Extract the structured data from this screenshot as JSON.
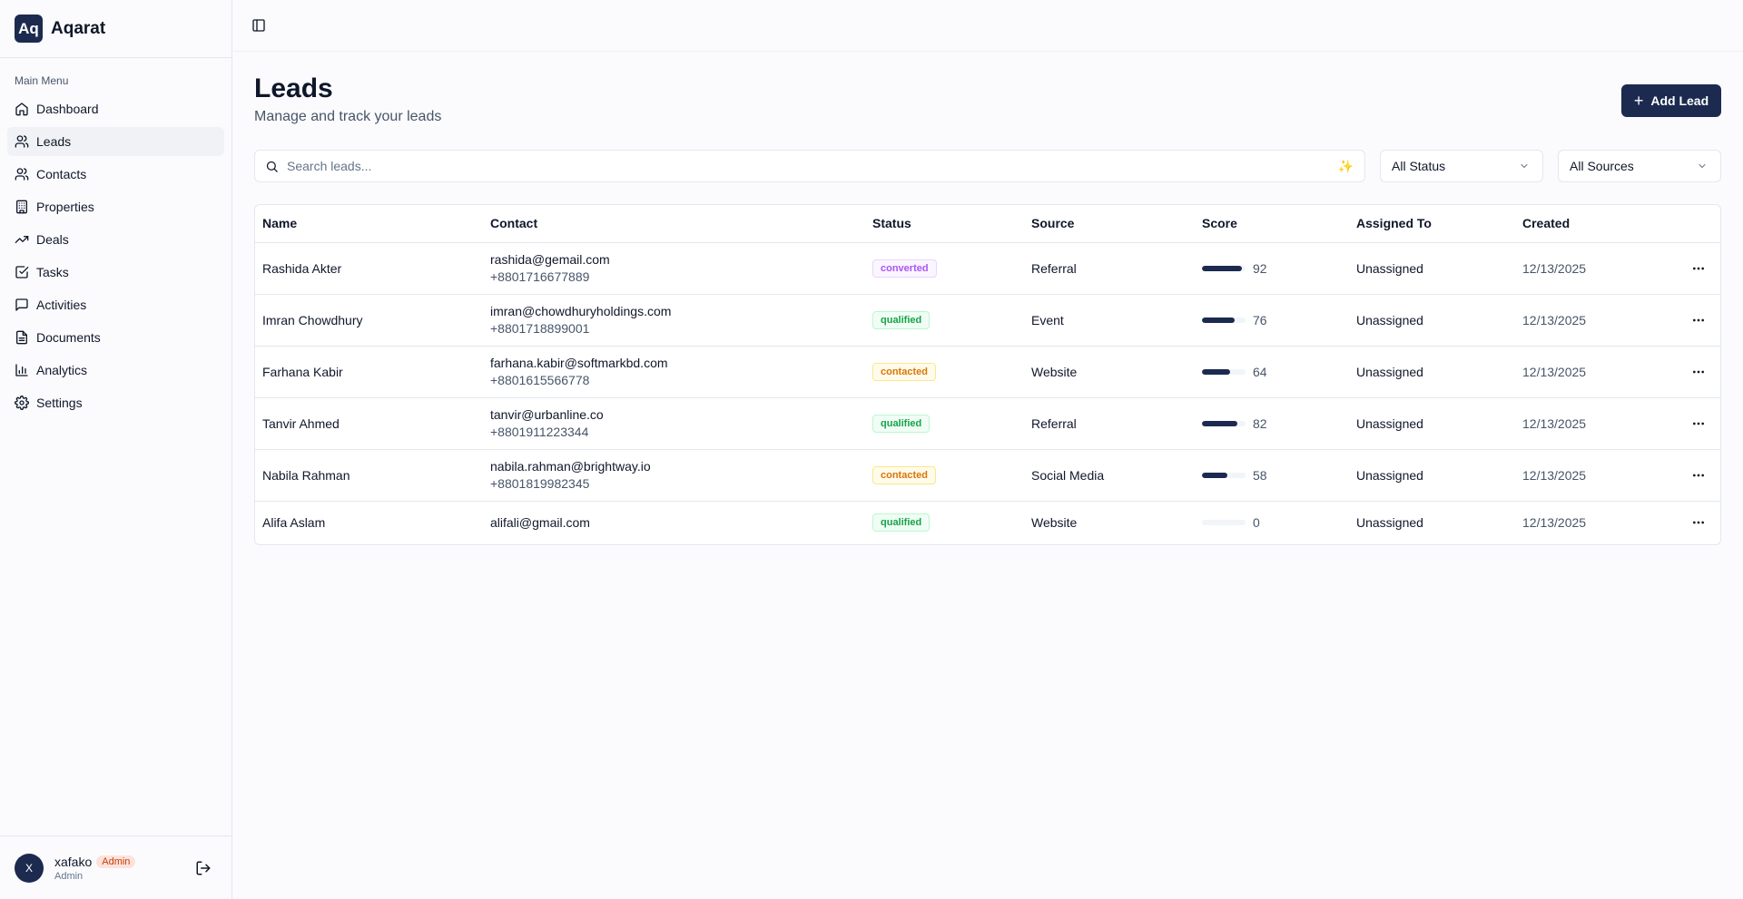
{
  "app": {
    "logo_text": "Aq",
    "name": "Aqarat"
  },
  "sidebar": {
    "heading": "Main Menu",
    "items": [
      {
        "label": "Dashboard",
        "icon": "home-icon",
        "active": false
      },
      {
        "label": "Leads",
        "icon": "users-icon",
        "active": true
      },
      {
        "label": "Contacts",
        "icon": "users-icon",
        "active": false
      },
      {
        "label": "Properties",
        "icon": "building-icon",
        "active": false
      },
      {
        "label": "Deals",
        "icon": "trending-up-icon",
        "active": false
      },
      {
        "label": "Tasks",
        "icon": "check-square-icon",
        "active": false
      },
      {
        "label": "Activities",
        "icon": "message-square-icon",
        "active": false
      },
      {
        "label": "Documents",
        "icon": "file-text-icon",
        "active": false
      },
      {
        "label": "Analytics",
        "icon": "bar-chart-icon",
        "active": false
      },
      {
        "label": "Settings",
        "icon": "gear-icon",
        "active": false
      }
    ]
  },
  "user": {
    "initial": "X",
    "name": "xafako",
    "badge": "Admin",
    "role": "Admin"
  },
  "page": {
    "title": "Leads",
    "subtitle": "Manage and track your leads",
    "add_button": "Add Lead"
  },
  "filters": {
    "search_placeholder": "Search leads...",
    "status": "All Status",
    "source": "All Sources"
  },
  "table": {
    "columns": [
      "Name",
      "Contact",
      "Status",
      "Source",
      "Score",
      "Assigned To",
      "Created"
    ],
    "rows": [
      {
        "name": "Rashida Akter",
        "email": "rashida@gemail.com",
        "phone": "+8801716677889",
        "status": "converted",
        "source": "Referral",
        "score": 92,
        "assigned": "Unassigned",
        "created": "12/13/2025"
      },
      {
        "name": "Imran Chowdhury",
        "email": "imran@chowdhuryholdings.com",
        "phone": "+8801718899001",
        "status": "qualified",
        "source": "Event",
        "score": 76,
        "assigned": "Unassigned",
        "created": "12/13/2025"
      },
      {
        "name": "Farhana Kabir",
        "email": "farhana.kabir@softmarkbd.com",
        "phone": "+8801615566778",
        "status": "contacted",
        "source": "Website",
        "score": 64,
        "assigned": "Unassigned",
        "created": "12/13/2025"
      },
      {
        "name": "Tanvir Ahmed",
        "email": "tanvir@urbanline.co",
        "phone": "+8801911223344",
        "status": "qualified",
        "source": "Referral",
        "score": 82,
        "assigned": "Unassigned",
        "created": "12/13/2025"
      },
      {
        "name": "Nabila Rahman",
        "email": "nabila.rahman@brightway.io",
        "phone": "+8801819982345",
        "status": "contacted",
        "source": "Social Media",
        "score": 58,
        "assigned": "Unassigned",
        "created": "12/13/2025"
      },
      {
        "name": "Alifa Aslam",
        "email": "alifali@gmail.com",
        "phone": "",
        "status": "qualified",
        "source": "Website",
        "score": 0,
        "assigned": "Unassigned",
        "created": "12/13/2025"
      }
    ]
  },
  "colors": {
    "primary": "#1b2a4e",
    "status": {
      "converted": {
        "text": "#a855f7",
        "bg": "#faf5ff",
        "border": "#e9d5ff"
      },
      "qualified": {
        "text": "#16a34a",
        "bg": "#f0fdf4",
        "border": "#bbf7d0"
      },
      "contacted": {
        "text": "#d97706",
        "bg": "#fffbeb",
        "border": "#fde68a"
      }
    }
  }
}
